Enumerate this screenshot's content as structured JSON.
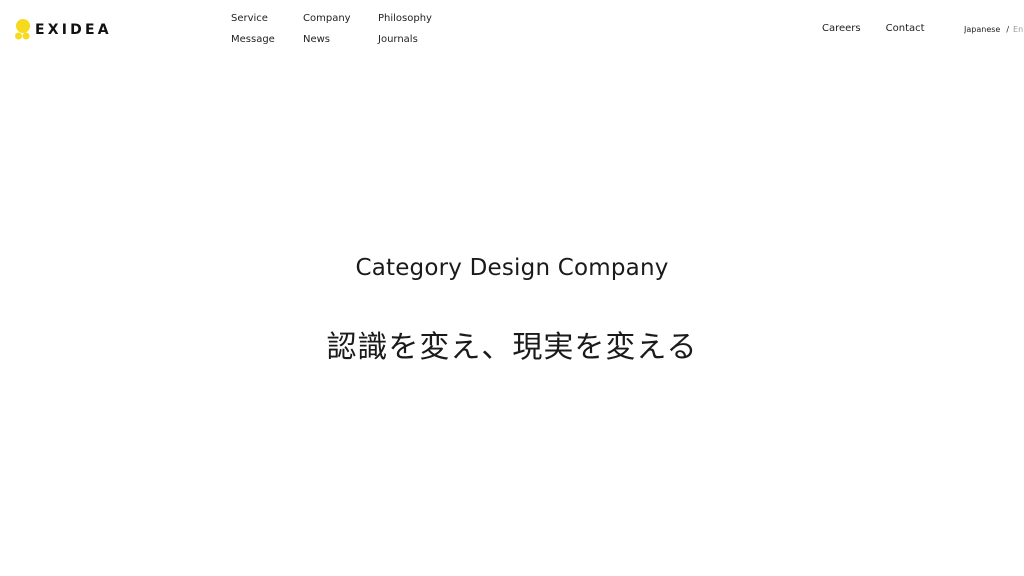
{
  "header": {
    "logo": {
      "text": "EXIDEA",
      "mark_color": "#F5DA1E"
    },
    "nav_primary": [
      {
        "label": "Service"
      },
      {
        "label": "Company"
      },
      {
        "label": "Philosophy"
      },
      {
        "label": "Message"
      },
      {
        "label": "News"
      },
      {
        "label": "Journals"
      }
    ],
    "nav_secondary": [
      {
        "label": "Careers"
      },
      {
        "label": "Contact"
      }
    ],
    "language": {
      "current": "Japanese",
      "separator": "/",
      "other": "En"
    }
  },
  "hero": {
    "title": "Category Design Company",
    "subtitle": "認識を変え、現実を変える"
  }
}
